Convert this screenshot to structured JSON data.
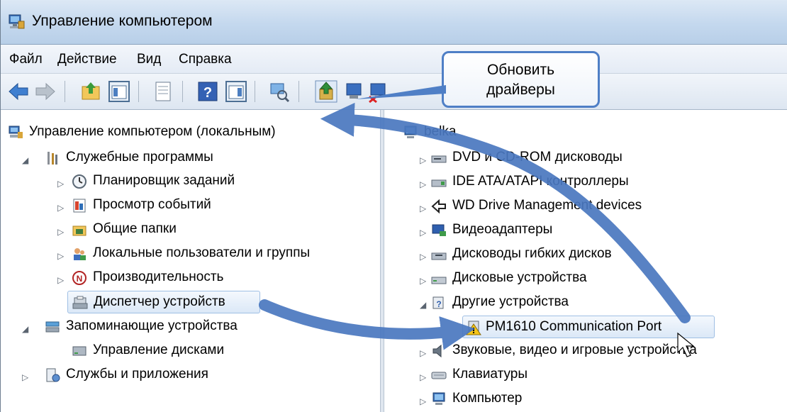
{
  "window": {
    "title": "Управление компьютером"
  },
  "menu": {
    "file": "Файл",
    "action": "Действие",
    "view": "Вид",
    "help": "Справка"
  },
  "callout": {
    "line1": "Обновить",
    "line2": "драйверы"
  },
  "left_tree": [
    {
      "label": "Управление компьютером (локальным)",
      "icon": "computer-management-icon"
    },
    {
      "label": "Служебные программы",
      "icon": "tools-icon"
    },
    {
      "label": "Планировщик заданий",
      "icon": "clock-icon"
    },
    {
      "label": "Просмотр событий",
      "icon": "event-viewer-icon"
    },
    {
      "label": "Общие папки",
      "icon": "shared-folder-icon"
    },
    {
      "label": "Локальные пользователи и группы",
      "icon": "users-icon"
    },
    {
      "label": "Производительность",
      "icon": "performance-icon"
    },
    {
      "label": "Диспетчер устройств",
      "icon": "device-manager-icon"
    },
    {
      "label": "Запоминающие устройства",
      "icon": "storage-icon"
    },
    {
      "label": "Управление дисками",
      "icon": "disk-management-icon"
    },
    {
      "label": "Службы и приложения",
      "icon": "services-icon"
    }
  ],
  "right_tree": [
    {
      "label": "belka",
      "icon": "computer-icon"
    },
    {
      "label": "DVD и CD-ROM дисководы",
      "icon": "dvd-drive-icon"
    },
    {
      "label": "IDE ATA/ATAPI контроллеры",
      "icon": "ide-controller-icon"
    },
    {
      "label": "WD Drive Management devices",
      "icon": "wd-device-icon"
    },
    {
      "label": "Видеоадаптеры",
      "icon": "display-adapter-icon"
    },
    {
      "label": "Дисководы гибких дисков",
      "icon": "floppy-drive-icon"
    },
    {
      "label": "Дисковые устройства",
      "icon": "disk-drive-icon"
    },
    {
      "label": "Другие устройства",
      "icon": "other-devices-icon"
    },
    {
      "label": "PM1610 Communication Port",
      "icon": "warning-device-icon"
    },
    {
      "label": "Звуковые, видео и игровые устройства",
      "icon": "sound-icon"
    },
    {
      "label": "Клавиатуры",
      "icon": "keyboard-icon"
    },
    {
      "label": "Компьютер",
      "icon": "computer-icon"
    }
  ]
}
